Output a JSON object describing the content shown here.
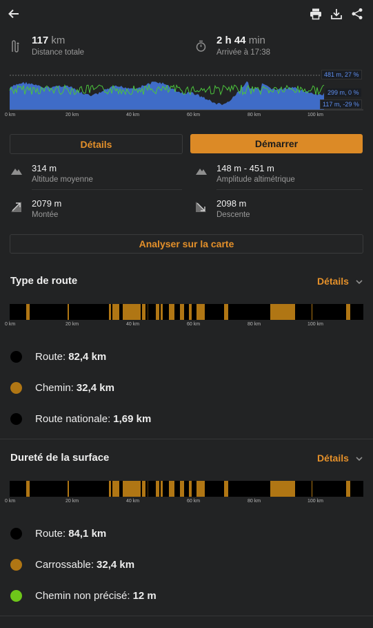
{
  "stats": {
    "distance": {
      "value": "117",
      "unit": "km",
      "label": "Distance totale"
    },
    "time": {
      "value": "2 h 44",
      "unit": "min",
      "label": "Arrivée à 17:38"
    }
  },
  "elevation_chart": {
    "x_ticks": [
      "0 km",
      "20 km",
      "40 km",
      "60 km",
      "80 km",
      "100 km"
    ],
    "badges": {
      "top": "481 m, 27 %",
      "mid": "299 m, 0 %",
      "bottom": "117 m, -29 %"
    },
    "colors": {
      "fill": "#3f6cc7",
      "slope": "#4cc53c",
      "badge_bg": "#1a1d22"
    }
  },
  "buttons": {
    "details": "Détails",
    "start": "Démarrer",
    "analyze": "Analyser sur la carte"
  },
  "info": {
    "avg_alt": {
      "value": "314 m",
      "label": "Altitude moyenne"
    },
    "alt_range": {
      "value": "148 m - 451 m",
      "label": "Amplitude altimétrique"
    },
    "ascent": {
      "value": "2079 m",
      "label": "Montée"
    },
    "descent": {
      "value": "2098 m",
      "label": "Descente"
    }
  },
  "road_type": {
    "title": "Type de route",
    "details": "Détails",
    "x_ticks": [
      "0 km",
      "20 km",
      "40 km",
      "60 km",
      "80 km",
      "100 km"
    ],
    "legend": [
      {
        "name": "Route:",
        "value": "82,4 km",
        "color": "#000000"
      },
      {
        "name": "Chemin:",
        "value": "32,4 km",
        "color": "#b07614"
      },
      {
        "name": "Route nationale:",
        "value": "1,69 km",
        "color": "#000000"
      }
    ]
  },
  "surface": {
    "title": "Dureté de la surface",
    "details": "Détails",
    "x_ticks": [
      "0 km",
      "20 km",
      "40 km",
      "60 km",
      "80 km",
      "100 km"
    ],
    "legend": [
      {
        "name": "Route:",
        "value": "84,1 km",
        "color": "#000000"
      },
      {
        "name": "Carrossable:",
        "value": "32,4 km",
        "color": "#b07614"
      },
      {
        "name": "Chemin non précisé:",
        "value": "12 m",
        "color": "#6ec61a"
      }
    ]
  }
}
